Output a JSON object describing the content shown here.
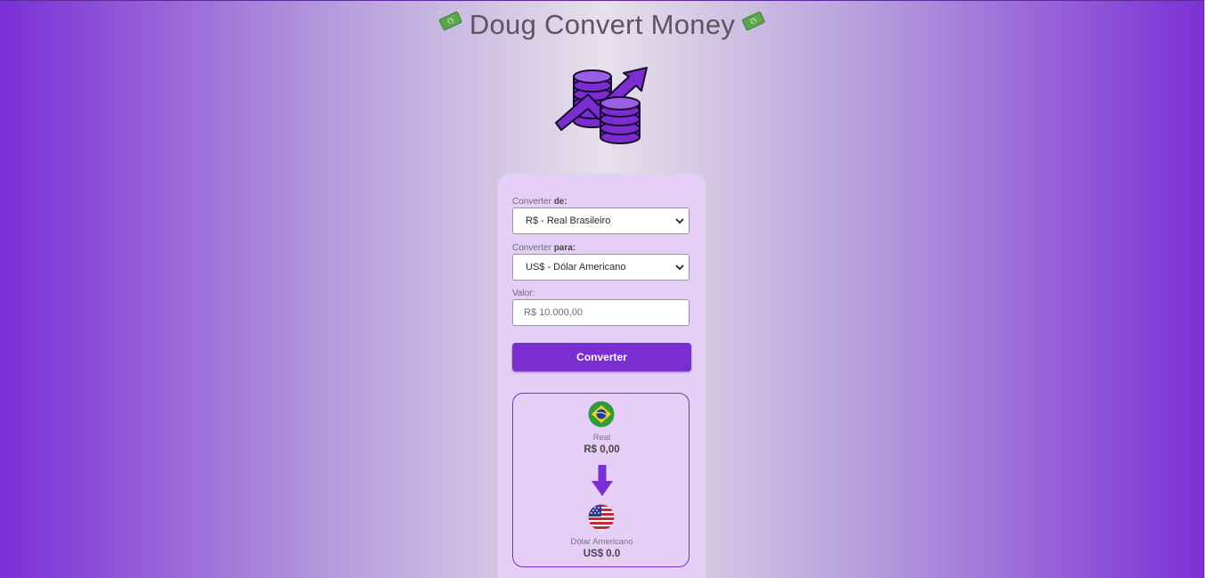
{
  "header": {
    "title": "Doug Convert Money",
    "money_icon_left": "money-with-wings-icon",
    "money_icon_right": "money-with-wings-icon"
  },
  "logo": {
    "icon": "coins-growth-icon"
  },
  "form": {
    "from_label_prefix": "Converter ",
    "from_label_bold": "de:",
    "from_value": "R$ - Real Brasileiro",
    "to_label_prefix": "Converter ",
    "to_label_bold": "para:",
    "to_value": "US$ - Dólar Americano",
    "amount_label": "Valor:",
    "amount_placeholder": "R$ 10.000,00",
    "convert_button": "Converter"
  },
  "result": {
    "from_currency_name": "Real",
    "from_currency_value": "R$ 0,00",
    "from_flag_icon": "brazil-flag-icon",
    "arrow_icon": "arrow-down-icon",
    "to_currency_name": "Dólar Americano",
    "to_currency_value": "US$ 0.0",
    "to_flag_icon": "usa-flag-icon"
  },
  "colors": {
    "accent": "#7a2dd1",
    "card": "#e6cff7",
    "edge": "#7b2fd6"
  }
}
